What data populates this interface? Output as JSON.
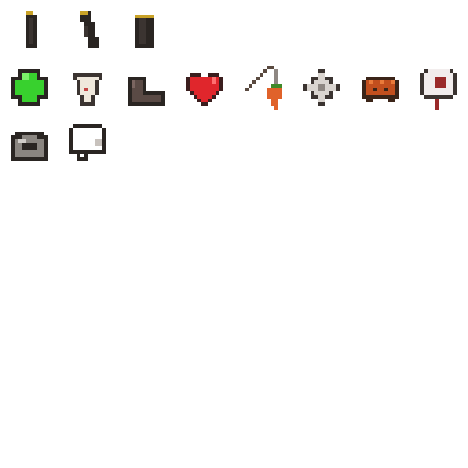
{
  "sheet": {
    "background": "#ffffff",
    "icons": [
      {
        "name": "small-battery-icon",
        "row": 0,
        "col": 0,
        "colors": [
          "#2a2522",
          "#3b3431",
          "#c9a227"
        ]
      },
      {
        "name": "tilted-battery-icon",
        "row": 0,
        "col": 1,
        "colors": [
          "#2a2522",
          "#3b3431",
          "#c9a227"
        ]
      },
      {
        "name": "large-battery-icon",
        "row": 0,
        "col": 2,
        "colors": [
          "#2a2522",
          "#3b3431",
          "#c9a227"
        ]
      },
      {
        "name": "green-cross-icon",
        "row": 1,
        "col": 0,
        "colors": [
          "#2a2522",
          "#38d12e",
          "#7cf26a"
        ]
      },
      {
        "name": "cow-skull-icon",
        "row": 1,
        "col": 1,
        "colors": [
          "#3b3431",
          "#efe8dc",
          "#c24545"
        ]
      },
      {
        "name": "boot-icon",
        "row": 1,
        "col": 2,
        "colors": [
          "#2a2522",
          "#5a4a45",
          "#7a6560"
        ]
      },
      {
        "name": "heart-icon",
        "row": 1,
        "col": 3,
        "colors": [
          "#3b1e1e",
          "#e0262c",
          "#ff7070"
        ]
      },
      {
        "name": "carrot-on-a-stick-icon",
        "row": 1,
        "col": 4,
        "colors": [
          "#5a4a40",
          "#e0622a",
          "#3f8a2a"
        ]
      },
      {
        "name": "shuriken-icon",
        "row": 1,
        "col": 5,
        "colors": [
          "#3b3431",
          "#d9d4cf",
          "#8e8782"
        ]
      },
      {
        "name": "spiked-shell-icon",
        "row": 1,
        "col": 6,
        "colors": [
          "#3b2418",
          "#c24f1e",
          "#ea7a3a"
        ]
      },
      {
        "name": "eyeball-icon",
        "row": 1,
        "col": 7,
        "colors": [
          "#3b3431",
          "#f2eded",
          "#9a2a2a"
        ]
      },
      {
        "name": "stone-ring-icon",
        "row": 2,
        "col": 0,
        "colors": [
          "#2a2522",
          "#8a8580",
          "#d0ccc8"
        ]
      },
      {
        "name": "speech-bubble-icon",
        "row": 2,
        "col": 1,
        "colors": [
          "#2a2522",
          "#ffffff",
          "#c8c2bd"
        ]
      }
    ]
  }
}
